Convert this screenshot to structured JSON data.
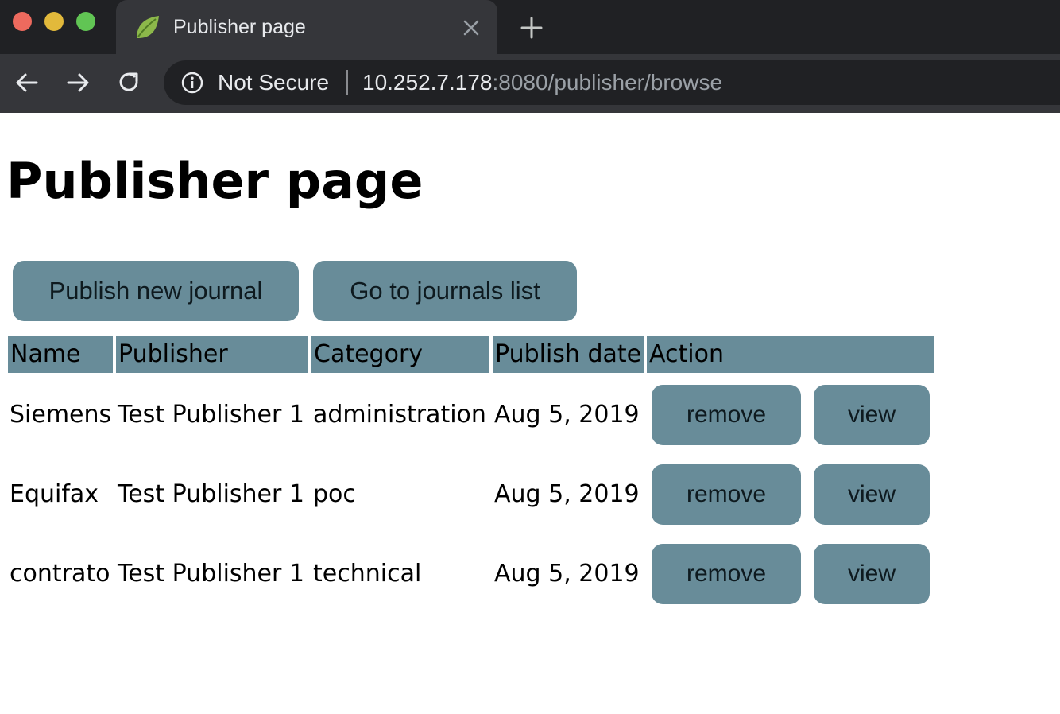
{
  "browser": {
    "tab": {
      "title": "Publisher page",
      "favicon": "spring-leaf-icon"
    },
    "address_bar": {
      "security_label": "Not Secure",
      "url_host": "10.252.7.178",
      "url_rest": ":8080/publisher/browse"
    }
  },
  "page": {
    "title": "Publisher page",
    "actions": {
      "publish_label": "Publish new journal",
      "goto_label": "Go to journals list"
    },
    "table": {
      "headers": [
        "Name",
        "Publisher",
        "Category",
        "Publish date",
        "Action"
      ],
      "rows": [
        {
          "name": "Siemens",
          "publisher": "Test Publisher 1",
          "category": "administration",
          "date": "Aug 5, 2019",
          "remove": "remove",
          "view": "view"
        },
        {
          "name": "Equifax",
          "publisher": "Test Publisher 1",
          "category": "poc",
          "date": "Aug 5, 2019",
          "remove": "remove",
          "view": "view"
        },
        {
          "name": "contrato",
          "publisher": "Test Publisher 1",
          "category": "technical",
          "date": "Aug 5, 2019",
          "remove": "remove",
          "view": "view"
        }
      ]
    }
  },
  "colors": {
    "button_bg": "#688c99",
    "chrome_dark": "#202124",
    "chrome_toolbar": "#35363a"
  }
}
